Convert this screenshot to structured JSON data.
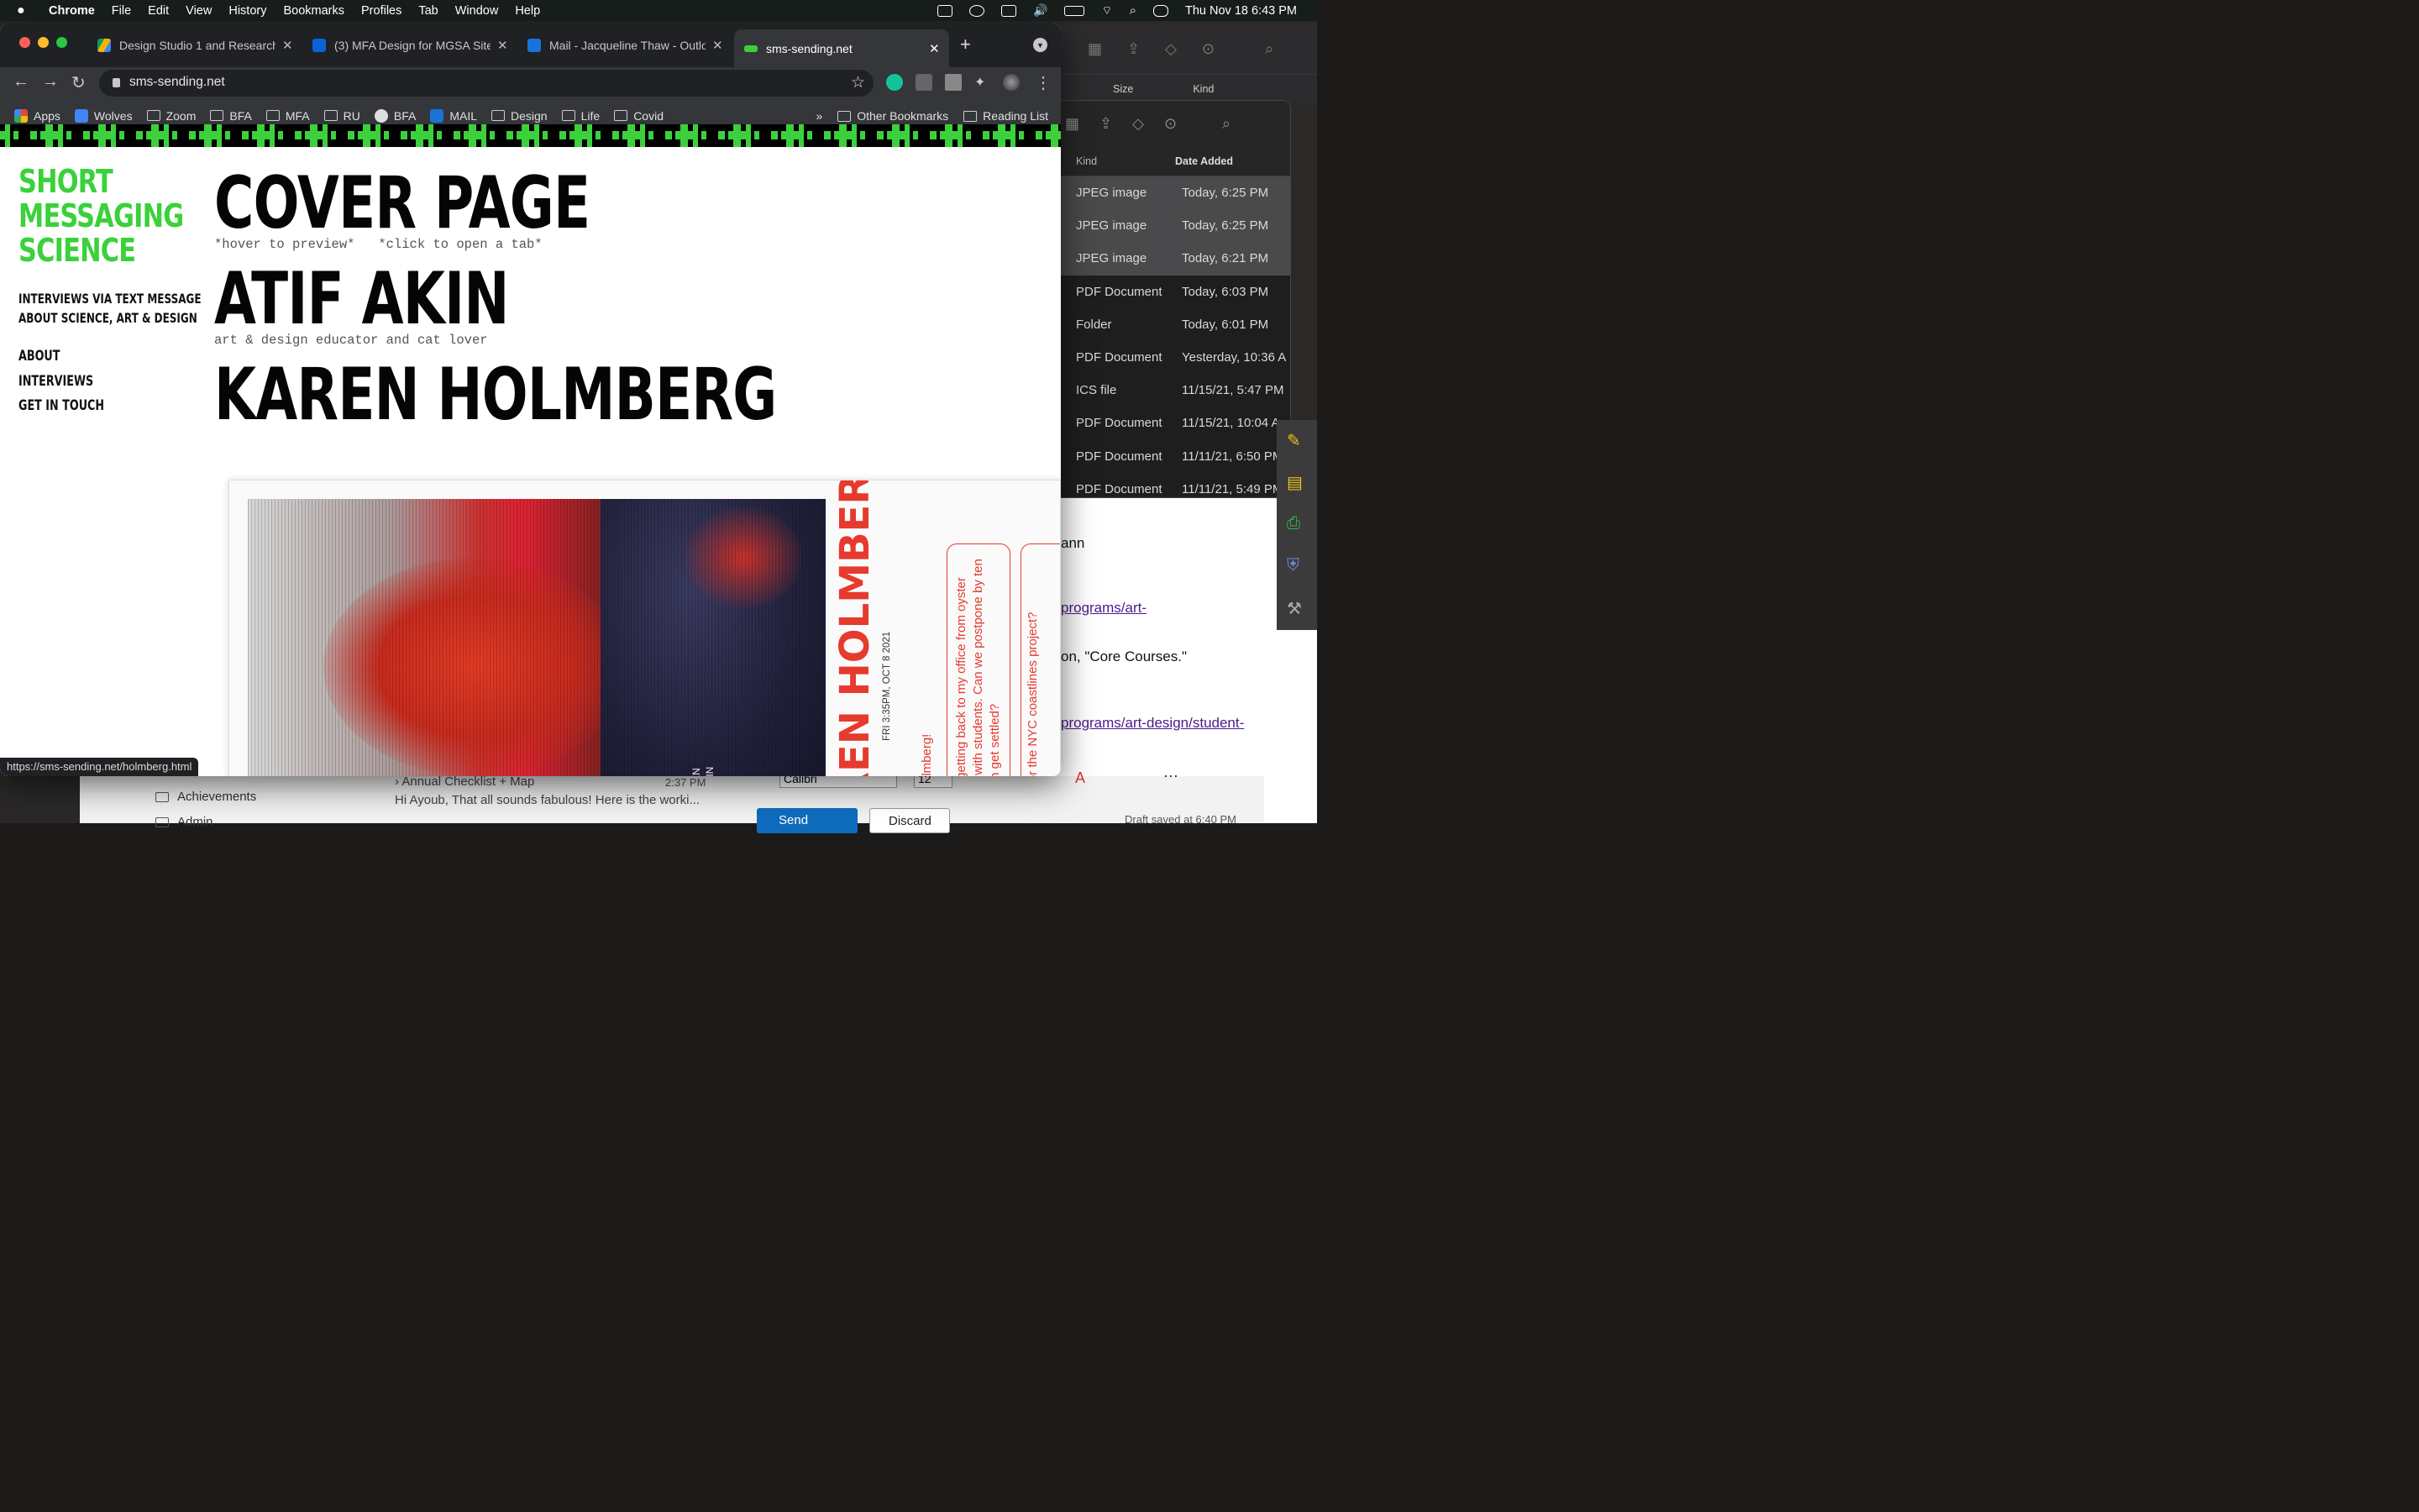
{
  "menubar": {
    "app": "Chrome",
    "items": [
      "File",
      "Edit",
      "View",
      "History",
      "Bookmarks",
      "Profiles",
      "Tab",
      "Window",
      "Help"
    ],
    "datetime": "Thu Nov 18  6:43 PM"
  },
  "tabs": [
    {
      "title": "Design Studio 1 and Research",
      "close": "✕"
    },
    {
      "title": "(3) MFA Design for MGSA Site",
      "close": "✕"
    },
    {
      "title": "Mail - Jacqueline Thaw - Outlo",
      "close": "✕"
    },
    {
      "title": "sms-sending.net",
      "close": "✕"
    }
  ],
  "new_tab": "+",
  "address": {
    "url": "sms-sending.net"
  },
  "bookmarks": [
    "Apps",
    "Wolves",
    "Zoom",
    "BFA",
    "MFA",
    "RU",
    "BFA",
    "MAIL",
    "Design",
    "Life",
    "Covid"
  ],
  "bookmarks_right": {
    "chevron": "»",
    "other": "Other Bookmarks",
    "reading": "Reading List"
  },
  "site": {
    "brand": [
      "SHORT",
      "MESSAGING",
      "SCIENCE"
    ],
    "tagline": [
      "INTERVIEWS VIA TEXT MESSAGE",
      "ABOUT SCIENCE, ART & DESIGN"
    ],
    "nav": [
      "ABOUT",
      "INTERVIEWS",
      "GET IN TOUCH"
    ],
    "headings": [
      {
        "title": "COVER PAGE",
        "sub": "*hover to preview*   *click to open a tab*"
      },
      {
        "title": "ATIF AKIN",
        "sub": "art & design educator and cat lover"
      },
      {
        "title": "KAREN HOLMBERG",
        "sub": ""
      }
    ],
    "preview": {
      "name": "REN HOLMBERG",
      "date": "FRI 3:35PM, OCT 8 2021",
      "greeting": "r Holmberg!",
      "msg1a": "ust getting back to my office from oyster",
      "msg1b": "ring with students. Can we postpone by ten",
      "msg1c": "I can get settled?",
      "msg2": "at for the NYC coastlines project?",
      "credit1": "EAVEN",
      "credit2": "E GUIN"
    },
    "status_url": "https://sms-sending.net/holmberg.html"
  },
  "finder_back": {
    "headers": [
      "Size",
      "Kind"
    ]
  },
  "finder_front": {
    "headers": [
      "Kind",
      "Date Added"
    ],
    "rows": [
      {
        "kind": "JPEG image",
        "date": "Today, 6:25 PM"
      },
      {
        "kind": "JPEG image",
        "date": "Today, 6:25 PM"
      },
      {
        "kind": "JPEG image",
        "date": "Today, 6:21 PM"
      },
      {
        "kind": "PDF Document",
        "date": "Today, 6:03 PM"
      },
      {
        "kind": "Folder",
        "date": "Today, 6:01 PM"
      },
      {
        "kind": "PDF Document",
        "date": "Yesterday, 10:36 A"
      },
      {
        "kind": "ICS file",
        "date": "11/15/21, 5:47 PM"
      },
      {
        "kind": "PDF Document",
        "date": "11/15/21, 10:04 A"
      },
      {
        "kind": "PDF Document",
        "date": "11/11/21, 6:50 PM"
      },
      {
        "kind": "PDF Document",
        "date": "11/11/21, 5:49 PM"
      }
    ]
  },
  "outlook": {
    "lines": [
      "ann",
      "programs/art-",
      "on, \"Core Courses.\"",
      "programs/art-design/student-"
    ],
    "folders": [
      "Achievements",
      "Admin"
    ],
    "mail_subject": "Annual Checklist + Map",
    "mail_time": "2:37 PM",
    "mail_preview": "Hi Ayoub, That all sounds fabulous! Here is the worki...",
    "font": "Calibri",
    "size": "12",
    "send": "Send",
    "discard": "Discard",
    "draft": "Draft saved at 6:40 PM"
  }
}
